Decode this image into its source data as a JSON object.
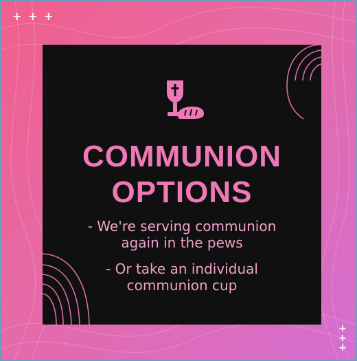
{
  "decor": {
    "plus_row": "+ + +",
    "plus_col": [
      "+",
      "+",
      "+"
    ]
  },
  "icon": {
    "name": "communion-chalice-bread-icon"
  },
  "title": {
    "line1": "COMMUNION",
    "line2": "OPTIONS"
  },
  "bullets": [
    {
      "line1": "- We're serving communion",
      "line2": "again in the pews"
    },
    {
      "line1": "- Or take an individual",
      "line2": "communion cup"
    }
  ],
  "colors": {
    "gradient_start": "#ef5f8c",
    "gradient_end": "#d46ed0",
    "card_background": "#101010",
    "title": "#ee79b6",
    "text": "#f2a2cb"
  }
}
